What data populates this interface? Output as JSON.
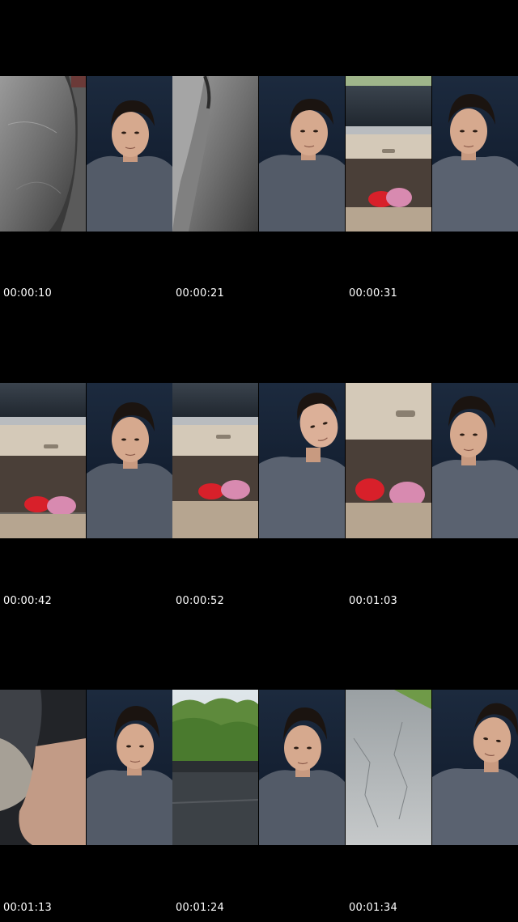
{
  "timestamps": [
    [
      "00:00:10",
      "00:00:21",
      "00:00:31"
    ],
    [
      "00:00:42",
      "00:00:52",
      "00:01:03"
    ],
    [
      "00:01:13",
      "00:01:24",
      "00:01:34"
    ]
  ],
  "frames": [
    [
      "fabric-closeup",
      "portrait",
      "fabric-closeup",
      "portrait",
      "car-dashboard",
      "portrait"
    ],
    [
      "car-dashboard",
      "portrait",
      "car-dashboard",
      "portrait-tilted",
      "car-dashboard",
      "portrait"
    ],
    [
      "car-interior-blur",
      "portrait",
      "trees-windshield",
      "portrait",
      "pavement",
      "portrait"
    ]
  ]
}
